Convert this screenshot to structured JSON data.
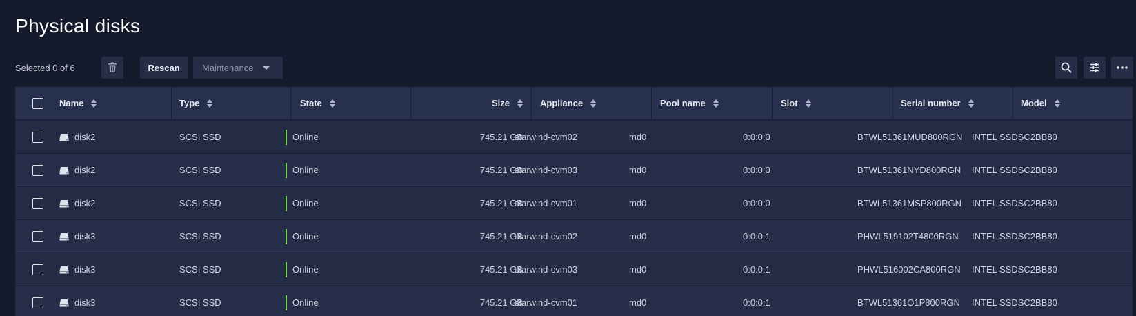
{
  "page": {
    "title": "Physical disks"
  },
  "toolbar": {
    "selected_text": "Selected 0 of 6",
    "rescan_label": "Rescan",
    "maintenance_label": "Maintenance",
    "icons": {
      "delete": "trash-icon",
      "search": "search-icon",
      "filter": "sliders-icon",
      "more": "more-icon"
    }
  },
  "colors": {
    "background": "#151a2c",
    "row": "#242b45",
    "button": "#252c45",
    "online": "#7fd35b"
  },
  "table": {
    "columns": [
      "Name",
      "Type",
      "State",
      "Size",
      "Appliance",
      "Pool name",
      "Slot",
      "Serial number",
      "Model"
    ],
    "rows": [
      {
        "name": "disk2",
        "type": "SCSI SSD",
        "state": "Online",
        "size": "745.21 GB",
        "appliance": "starwind-cvm02",
        "pool": "md0",
        "slot": "0:0:0:0",
        "serial": "BTWL51361MUD800RGN",
        "model": "INTEL SSDSC2BB80"
      },
      {
        "name": "disk2",
        "type": "SCSI SSD",
        "state": "Online",
        "size": "745.21 GB",
        "appliance": "starwind-cvm03",
        "pool": "md0",
        "slot": "0:0:0:0",
        "serial": "BTWL51361NYD800RGN",
        "model": "INTEL SSDSC2BB80"
      },
      {
        "name": "disk2",
        "type": "SCSI SSD",
        "state": "Online",
        "size": "745.21 GB",
        "appliance": "starwind-cvm01",
        "pool": "md0",
        "slot": "0:0:0:0",
        "serial": "BTWL51361MSP800RGN",
        "model": "INTEL SSDSC2BB80"
      },
      {
        "name": "disk3",
        "type": "SCSI SSD",
        "state": "Online",
        "size": "745.21 GB",
        "appliance": "starwind-cvm02",
        "pool": "md0",
        "slot": "0:0:0:1",
        "serial": "PHWL519102T4800RGN",
        "model": "INTEL SSDSC2BB80"
      },
      {
        "name": "disk3",
        "type": "SCSI SSD",
        "state": "Online",
        "size": "745.21 GB",
        "appliance": "starwind-cvm03",
        "pool": "md0",
        "slot": "0:0:0:1",
        "serial": "PHWL516002CA800RGN",
        "model": "INTEL SSDSC2BB80"
      },
      {
        "name": "disk3",
        "type": "SCSI SSD",
        "state": "Online",
        "size": "745.21 GB",
        "appliance": "starwind-cvm01",
        "pool": "md0",
        "slot": "0:0:0:1",
        "serial": "BTWL51361O1P800RGN",
        "model": "INTEL SSDSC2BB80"
      }
    ]
  }
}
